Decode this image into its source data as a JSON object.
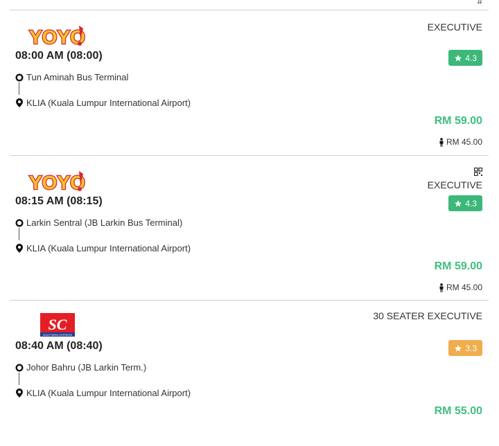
{
  "top_fragment": "#",
  "cards": [
    {
      "logo": "yoyo-logo",
      "class": "EXECUTIVE",
      "time": "08:00 AM (08:00)",
      "from": "Tun Aminah Bus Terminal",
      "to": "KLIA (Kuala Lumpur International Airport)",
      "rating": "4.3",
      "rating_color": "#3cb878",
      "price": "RM 59.00",
      "child_price": "RM 45.00"
    },
    {
      "logo": "yoyo-logo",
      "class": "EXECUTIVE",
      "time": "08:15 AM (08:15)",
      "from": "Larkin Sentral (JB Larkin Bus Terminal)",
      "to": "KLIA (Kuala Lumpur International Airport)",
      "rating": "4.3",
      "rating_color": "#3cb878",
      "price": "RM 59.00",
      "child_price": "RM 45.00"
    },
    {
      "logo": "southern-express-logo",
      "logo_text": "SC",
      "logo_subtext": "SOUTHERN EXPRESS",
      "class": "30 SEATER EXECUTIVE",
      "time": "08:40 AM (08:40)",
      "from": "Johor Bahru (JB Larkin Term.)",
      "to": "KLIA (Kuala Lumpur International Airport)",
      "rating": "3.3",
      "rating_color": "#f0ad4e",
      "price": "RM 55.00"
    }
  ],
  "colors": {
    "price": "#3fbf7f",
    "divider": "#cfcfcf"
  }
}
